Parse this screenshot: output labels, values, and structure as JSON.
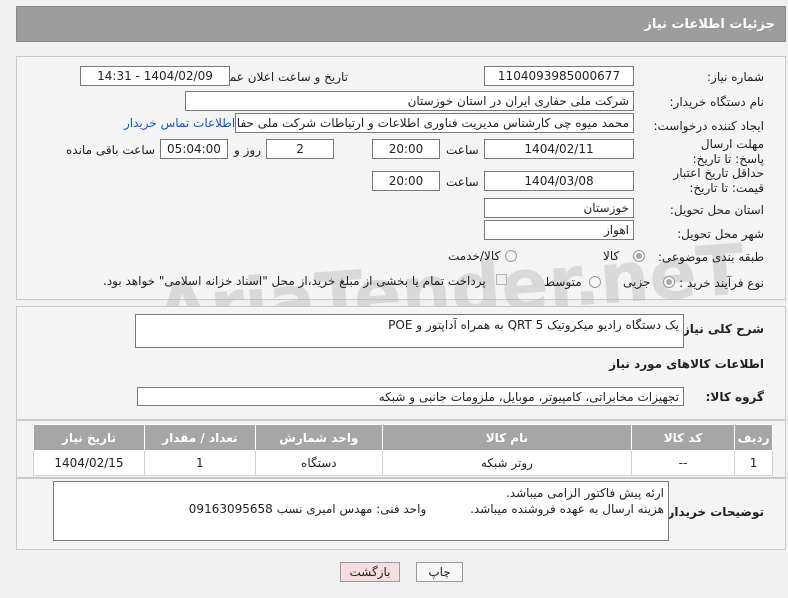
{
  "header": {
    "title": "جزئیات اطلاعات نیاز"
  },
  "fields": {
    "need_number_label": "شماره نیاز:",
    "need_number": "1104093985000677",
    "announce_label": "تاریخ و ساعت اعلان عمومی:",
    "announce_value": "1404/02/09 - 14:31",
    "buyer_org_label": "نام دستگاه خریدار:",
    "buyer_org": "شرکت ملی حفاری ایران در استان خوزستان",
    "creator_label": "ایجاد کننده درخواست:",
    "creator": "محمد میوه چی کارشناس مدیریت فناوری اطلاعات و ارتباطات  شرکت ملی حفاری",
    "contact_link": "اطلاعات تماس خریدار",
    "deadline_label": "مهلت ارسال پاسخ: تا تاریخ:",
    "deadline_date": "1404/02/11",
    "time_label": "ساعت",
    "deadline_time": "20:00",
    "days_value": "2",
    "days_label": "روز و",
    "remaining_time": "05:04:00",
    "remaining_label": "ساعت باقی مانده",
    "validity_label": "حداقل تاریخ اعتبار قیمت: تا تاریخ:",
    "validity_date": "1404/03/08",
    "validity_time_label": "ساعت",
    "validity_time": "20:00",
    "province_label": "استان محل تحویل:",
    "province": "خوزستان",
    "city_label": "شهر محل تحویل:",
    "city": "اهواز",
    "category_label": "طبقه بندی موضوعی:",
    "category_options": [
      "کالا",
      "کالا/خدمت"
    ],
    "category_selected": "کالا",
    "purchase_type_label": "نوع فرآیند خرید :",
    "purchase_options": [
      "جزیی",
      "متوسط"
    ],
    "purchase_selected": "جزیی",
    "payment_note": "پرداخت تمام یا بخشی از مبلغ خرید،از محل \"اسناد خزانه اسلامی\" خواهد بود."
  },
  "description": {
    "label": "شرح کلی نیاز:",
    "value": "یک دستگاه رادیو میکروتیک QRT 5 به همراه آداپتور و POE"
  },
  "goods": {
    "section_title": "اطلاعات کالاهای مورد نیاز",
    "group_label": "گروه کالا:",
    "group_value": "تجهیزات مخابراتی، کامپیوتر، موبایل، ملزومات جانبی و شبکه",
    "columns": [
      "ردیف",
      "کد کالا",
      "نام کالا",
      "واحد شمارش",
      "تعداد / مقدار",
      "تاریخ نیاز"
    ],
    "rows": [
      [
        "1",
        "--",
        "روتر شبکه",
        "دستگاه",
        "1",
        "1404/02/15"
      ]
    ]
  },
  "buyer_notes": {
    "label": "توضیحات خریدار:",
    "line1": "ارئه پیش فاکتور الزامی میباشد.",
    "line2": "هزینه ارسال به عهده فروشنده میباشد.",
    "line2_contact": "واحد فنی: مهدس امیری نسب 09163095658"
  },
  "buttons": {
    "print": "چاپ",
    "back": "بازگشت"
  },
  "watermark": "AriaTender.neT",
  "colors": {
    "header_bg": "#9c9c9c",
    "link": "#1a56c8",
    "back_button_bg": "#f8dede"
  }
}
